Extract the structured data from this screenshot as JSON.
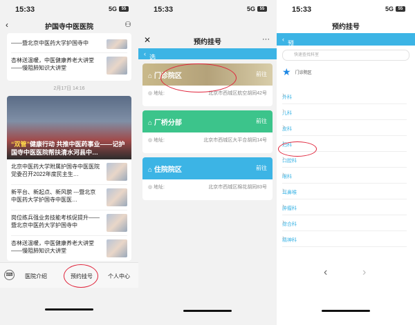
{
  "phone1": {
    "time": "15:33",
    "signal": "5G",
    "battery": "55",
    "title": "护国寺中医医院",
    "items_top": [
      "——暨北京中医药大学护国寺中",
      "杏林送温暖，中医健康养老大讲堂——慢阻肺知识大讲堂"
    ],
    "date": "2月17日 14:16",
    "hero_caption_y": "“双管”",
    "hero_caption": "健康行动 共推中医药事业——记护国寺中医医院帮扶清水河县中…",
    "items": [
      "北京中医药大学附属护国寺中医医院党委召开2022年度民主生…",
      "新平台、新起点、新风貌 ---暨北京中医药大学护国寺中医医…",
      "岗位练兵强业务技能考核促提升——暨北京中医药大学护国寺中",
      "杏林送温暖，中医健康养老大讲堂——慢阻肺知识大讲堂"
    ],
    "tabs": [
      "医院介绍",
      "预约挂号",
      "个人中心"
    ]
  },
  "phone2": {
    "time": "15:33",
    "title": "预约挂号",
    "subhead": "选择院区",
    "campuses": [
      {
        "name": "门诊院区",
        "go": "前往",
        "addr_label": "地址:",
        "addr": "北京市西城区航空胡同42号",
        "color": "#c9b98a"
      },
      {
        "name": "厂桥分部",
        "go": "前往",
        "addr_label": "地址:",
        "addr": "北京市西城区大平合胡同14号",
        "color": "#3cc48b"
      },
      {
        "name": "住院院区",
        "go": "前往",
        "addr_label": "地址:",
        "addr": "北京市西城区棉花胡同83号",
        "color": "#3cb4e5"
      }
    ]
  },
  "phone3": {
    "time": "15:33",
    "title": "预约挂号",
    "subhead": "预约科室选择",
    "search_placeholder": "快速查找科室",
    "outpatient": "门诊院区",
    "departments": [
      "外科",
      "儿科",
      "皮科",
      "妇科",
      "口腔科",
      "眼科",
      "耳鼻喉",
      "肿瘤科",
      "综合科",
      "精神科"
    ]
  }
}
